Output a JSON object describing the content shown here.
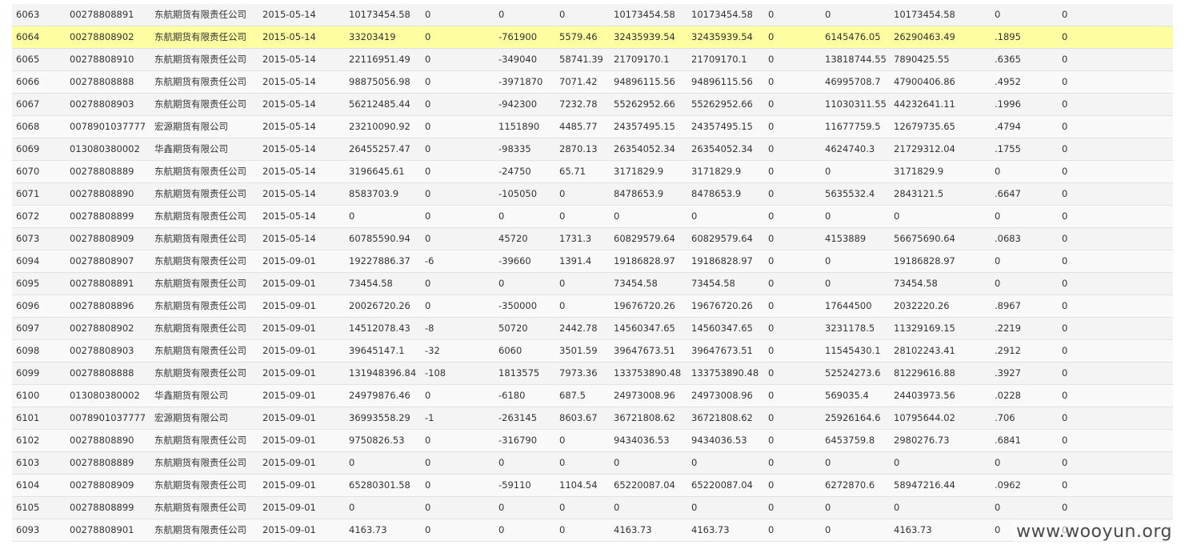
{
  "table": {
    "rows": [
      {
        "cells": [
          "6063",
          "00278808891",
          "东航期货有限责任公司",
          "2015-05-14",
          "10173454.58",
          "0",
          "0",
          "0",
          "10173454.58",
          "10173454.58",
          "0",
          "0",
          "10173454.58",
          "0",
          "0"
        ]
      },
      {
        "cells": [
          "6064",
          "00278808902",
          "东航期货有限责任公司",
          "2015-05-14",
          "33203419",
          "0",
          "-761900",
          "5579.46",
          "32435939.54",
          "32435939.54",
          "0",
          "6145476.05",
          "26290463.49",
          ".1895",
          "0"
        ],
        "selected": true
      },
      {
        "cells": [
          "6065",
          "00278808910",
          "东航期货有限责任公司",
          "2015-05-14",
          "22116951.49",
          "0",
          "-349040",
          "58741.39",
          "21709170.1",
          "21709170.1",
          "0",
          "13818744.55",
          "7890425.55",
          ".6365",
          "0"
        ]
      },
      {
        "cells": [
          "6066",
          "00278808888",
          "东航期货有限责任公司",
          "2015-05-14",
          "98875056.98",
          "0",
          "-3971870",
          "7071.42",
          "94896115.56",
          "94896115.56",
          "0",
          "46995708.7",
          "47900406.86",
          ".4952",
          "0"
        ]
      },
      {
        "cells": [
          "6067",
          "00278808903",
          "东航期货有限责任公司",
          "2015-05-14",
          "56212485.44",
          "0",
          "-942300",
          "7232.78",
          "55262952.66",
          "55262952.66",
          "0",
          "11030311.55",
          "44232641.11",
          ".1996",
          "0"
        ]
      },
      {
        "cells": [
          "6068",
          "0078901037777",
          "宏源期货有限公司",
          "2015-05-14",
          "23210090.92",
          "0",
          "1151890",
          "4485.77",
          "24357495.15",
          "24357495.15",
          "0",
          "11677759.5",
          "12679735.65",
          ".4794",
          "0"
        ]
      },
      {
        "cells": [
          "6069",
          "013080380002",
          "华鑫期货有限公司",
          "2015-05-14",
          "26455257.47",
          "0",
          "-98335",
          "2870.13",
          "26354052.34",
          "26354052.34",
          "0",
          "4624740.3",
          "21729312.04",
          ".1755",
          "0"
        ]
      },
      {
        "cells": [
          "6070",
          "00278808889",
          "东航期货有限责任公司",
          "2015-05-14",
          "3196645.61",
          "0",
          "-24750",
          "65.71",
          "3171829.9",
          "3171829.9",
          "0",
          "0",
          "3171829.9",
          "0",
          "0"
        ]
      },
      {
        "cells": [
          "6071",
          "00278808890",
          "东航期货有限责任公司",
          "2015-05-14",
          "8583703.9",
          "0",
          "-105050",
          "0",
          "8478653.9",
          "8478653.9",
          "0",
          "5635532.4",
          "2843121.5",
          ".6647",
          "0"
        ]
      },
      {
        "cells": [
          "6072",
          "00278808899",
          "东航期货有限责任公司",
          "2015-05-14",
          "0",
          "0",
          "0",
          "0",
          "0",
          "0",
          "0",
          "0",
          "0",
          "0",
          "0"
        ]
      },
      {
        "cells": [
          "6073",
          "00278808909",
          "东航期货有限责任公司",
          "2015-05-14",
          "60785590.94",
          "0",
          "45720",
          "1731.3",
          "60829579.64",
          "60829579.64",
          "0",
          "4153889",
          "56675690.64",
          ".0683",
          "0"
        ]
      },
      {
        "cells": [
          "6094",
          "00278808907",
          "东航期货有限责任公司",
          "2015-09-01",
          "19227886.37",
          "-6",
          "-39660",
          "1391.4",
          "19186828.97",
          "19186828.97",
          "0",
          "0",
          "19186828.97",
          "0",
          "0"
        ]
      },
      {
        "cells": [
          "6095",
          "00278808891",
          "东航期货有限责任公司",
          "2015-09-01",
          "73454.58",
          "0",
          "0",
          "0",
          "73454.58",
          "73454.58",
          "0",
          "0",
          "73454.58",
          "0",
          "0"
        ]
      },
      {
        "cells": [
          "6096",
          "00278808896",
          "东航期货有限责任公司",
          "2015-09-01",
          "20026720.26",
          "0",
          "-350000",
          "0",
          "19676720.26",
          "19676720.26",
          "0",
          "17644500",
          "2032220.26",
          ".8967",
          "0"
        ]
      },
      {
        "cells": [
          "6097",
          "00278808902",
          "东航期货有限责任公司",
          "2015-09-01",
          "14512078.43",
          "-8",
          "50720",
          "2442.78",
          "14560347.65",
          "14560347.65",
          "0",
          "3231178.5",
          "11329169.15",
          ".2219",
          "0"
        ]
      },
      {
        "cells": [
          "6098",
          "00278808903",
          "东航期货有限责任公司",
          "2015-09-01",
          "39645147.1",
          "-32",
          "6060",
          "3501.59",
          "39647673.51",
          "39647673.51",
          "0",
          "11545430.1",
          "28102243.41",
          ".2912",
          "0"
        ]
      },
      {
        "cells": [
          "6099",
          "00278808888",
          "东航期货有限责任公司",
          "2015-09-01",
          "131948396.84",
          "-108",
          "1813575",
          "7973.36",
          "133753890.48",
          "133753890.48",
          "0",
          "52524273.6",
          "81229616.88",
          ".3927",
          "0"
        ]
      },
      {
        "cells": [
          "6100",
          "013080380002",
          "华鑫期货有限公司",
          "2015-09-01",
          "24979876.46",
          "0",
          "-6180",
          "687.5",
          "24973008.96",
          "24973008.96",
          "0",
          "569035.4",
          "24403973.56",
          ".0228",
          "0"
        ]
      },
      {
        "cells": [
          "6101",
          "0078901037777",
          "宏源期货有限公司",
          "2015-09-01",
          "36993558.29",
          "-1",
          "-263145",
          "8603.67",
          "36721808.62",
          "36721808.62",
          "0",
          "25926164.6",
          "10795644.02",
          ".706",
          "0"
        ]
      },
      {
        "cells": [
          "6102",
          "00278808890",
          "东航期货有限责任公司",
          "2015-09-01",
          "9750826.53",
          "0",
          "-316790",
          "0",
          "9434036.53",
          "9434036.53",
          "0",
          "6453759.8",
          "2980276.73",
          ".6841",
          "0"
        ]
      },
      {
        "cells": [
          "6103",
          "00278808889",
          "东航期货有限责任公司",
          "2015-09-01",
          "0",
          "0",
          "0",
          "0",
          "0",
          "0",
          "0",
          "0",
          "0",
          "0",
          "0"
        ]
      },
      {
        "cells": [
          "6104",
          "00278808909",
          "东航期货有限责任公司",
          "2015-09-01",
          "65280301.58",
          "0",
          "-59110",
          "1104.54",
          "65220087.04",
          "65220087.04",
          "0",
          "6272870.6",
          "58947216.44",
          ".0962",
          "0"
        ]
      },
      {
        "cells": [
          "6105",
          "00278808899",
          "东航期货有限责任公司",
          "2015-09-01",
          "0",
          "0",
          "0",
          "0",
          "0",
          "0",
          "0",
          "0",
          "0",
          "0",
          "0"
        ]
      },
      {
        "cells": [
          "6093",
          "00278808901",
          "东航期货有限责任公司",
          "2015-09-01",
          "4163.73",
          "0",
          "0",
          "0",
          "4163.73",
          "4163.73",
          "0",
          "0",
          "4163.73",
          "0",
          "0"
        ]
      }
    ]
  },
  "watermark": "www.wooyun.org",
  "colors": {
    "row_bg": "#f4f4f4",
    "row_alt_bg": "#f9f9f9",
    "selected_bg": "#fefea0",
    "text": "#333333",
    "border": "#e2e2e2"
  }
}
